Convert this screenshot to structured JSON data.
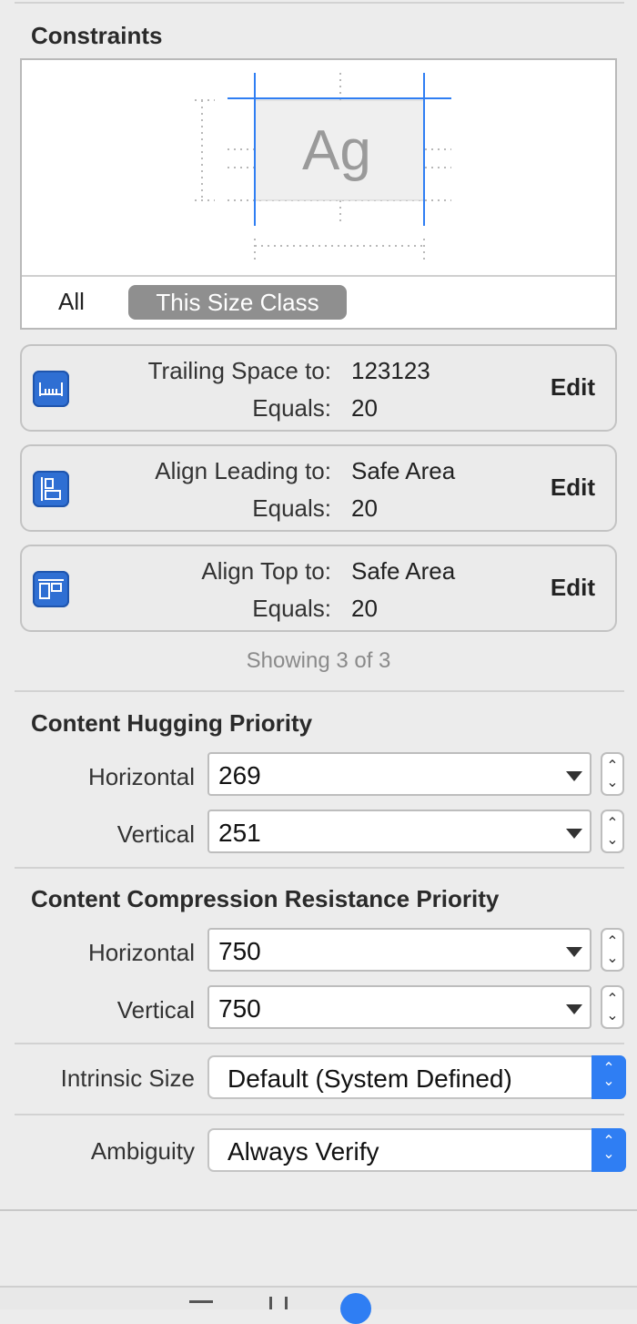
{
  "constraints": {
    "title": "Constraints",
    "preview_glyph": "Ag",
    "tabs": {
      "all": "All",
      "size_class": "This Size Class"
    },
    "items": [
      {
        "icon": "trailing-space-icon",
        "label": "Trailing Space to:",
        "target": "123123",
        "equals_label": "Equals:",
        "equals_value": "20",
        "edit": "Edit"
      },
      {
        "icon": "align-leading-icon",
        "label": "Align Leading to:",
        "target": "Safe Area",
        "equals_label": "Equals:",
        "equals_value": "20",
        "edit": "Edit"
      },
      {
        "icon": "align-top-icon",
        "label": "Align Top to:",
        "target": "Safe Area",
        "equals_label": "Equals:",
        "equals_value": "20",
        "edit": "Edit"
      }
    ],
    "showing": "Showing 3 of 3"
  },
  "hugging": {
    "title": "Content Hugging Priority",
    "horizontal_label": "Horizontal",
    "horizontal_value": "269",
    "vertical_label": "Vertical",
    "vertical_value": "251"
  },
  "compression": {
    "title": "Content Compression Resistance Priority",
    "horizontal_label": "Horizontal",
    "horizontal_value": "750",
    "vertical_label": "Vertical",
    "vertical_value": "750"
  },
  "intrinsic": {
    "label": "Intrinsic Size",
    "value": "Default (System Defined)"
  },
  "ambiguity": {
    "label": "Ambiguity",
    "value": "Always Verify"
  },
  "colors": {
    "accent": "#2f7ef3",
    "icon_blue": "#2f6fd3",
    "selected_tab": "#8f8f8f"
  }
}
